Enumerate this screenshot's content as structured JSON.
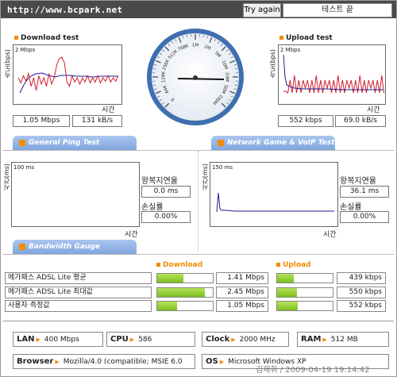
{
  "header": {
    "url": "http://www.bcpark.net",
    "try_again": "Try again",
    "test_status": "테스트 끝"
  },
  "download": {
    "title": "Download test",
    "y_axis": "속도(bps)",
    "scale": "2 Mbps",
    "x_axis": "시간",
    "mbps": "1.05 Mbps",
    "kbs": "131 kB/s",
    "series_fraction": [
      0.5,
      0.38,
      0.55,
      0.42,
      0.6,
      0.3,
      0.5,
      0.2,
      0.55,
      0.35,
      0.5,
      0.3,
      0.6,
      0.35,
      0.5,
      0.8,
      0.95,
      0.98,
      0.85,
      0.4,
      0.3,
      0.55,
      0.4,
      0.5,
      0.35,
      0.5,
      0.4,
      0.55,
      0.38,
      0.5,
      0.4,
      0.55,
      0.38,
      0.5,
      0.42,
      0.55,
      0.4,
      0.5,
      0.42,
      0.55
    ]
  },
  "upload": {
    "title": "Upload test",
    "y_axis": "속도(bps)",
    "scale": "2 Mbps",
    "x_axis": "시간",
    "kbps": "552 kbps",
    "kbs": "69.0 kB/s"
  },
  "gauge": {
    "ticks": [
      "0",
      "64K",
      "128K",
      "256K",
      "512K",
      "768K",
      "1M",
      "2M",
      "5M",
      "10M",
      "20M",
      "50M",
      "100M"
    ],
    "needle_value": "1M"
  },
  "ping": {
    "tab_label": "General Ping Test",
    "y_axis": "시간(ms)",
    "scale": "100 ms",
    "x_axis": "시간",
    "latency_label": "왕복지연율",
    "latency": "0.0 ms",
    "loss_label": "손실률",
    "loss": "0.00%"
  },
  "game": {
    "tab_label": "Network Game & VoIP Test",
    "y_axis": "시간(ms)",
    "scale": "150 ms",
    "x_axis": "시간",
    "latency_label": "왕복지연율",
    "latency": "36.1 ms",
    "loss_label": "손실률",
    "loss": "0.00%"
  },
  "bandwidth": {
    "tab_label": "Bandwidth Gauge",
    "download_label": "Download",
    "upload_label": "Upload",
    "rows": [
      {
        "label": "메가패스 ADSL Lite 평균",
        "down": "1.41 Mbps",
        "down_frac": 0.47,
        "up": "439 kbps",
        "up_frac": 0.3
      },
      {
        "label": "메가패스 ADSL Lite 최대값",
        "down": "2.45 Mbps",
        "down_frac": 0.85,
        "up": "550 kbps",
        "up_frac": 0.36
      },
      {
        "label": "사용자 측정값",
        "down": "1.05 Mbps",
        "down_frac": 0.36,
        "up": "552 kbps",
        "up_frac": 0.37
      }
    ]
  },
  "system": {
    "lan_label": "LAN",
    "lan": "400 Mbps",
    "cpu_label": "CPU",
    "cpu": "586",
    "clock_label": "Clock",
    "clock": "2000 MHz",
    "ram_label": "RAM",
    "ram": "512 MB",
    "browser_label": "Browser",
    "browser": "Mozilla/4.0 (compatible; MSIE 6.0",
    "os_label": "OS",
    "os": "Microsoft Windows XP"
  },
  "watermark": "김재휘 / 2009-04-19 19:14:42",
  "colors": {
    "accent": "#f28c00",
    "bar_green": "#8ccc2a",
    "tab_blue": "#8fb2e6",
    "line_red": "#d21f2a",
    "line_blue": "#1c1c9c"
  }
}
